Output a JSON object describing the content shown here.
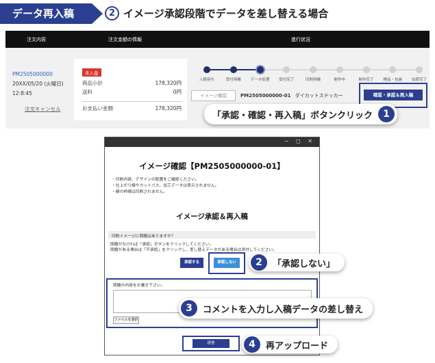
{
  "header": {
    "section_label": "データ再入稿",
    "step_number": "2",
    "step_title": "イメージ承認段階でデータを差し替える場合"
  },
  "table_header": {
    "col_order": "注文内容",
    "col_amount": "注文金額の情報",
    "col_status": "進行状況"
  },
  "order": {
    "id": "PM2505000000",
    "date": "20XX/05/20 (火曜日)",
    "time": "12:8:45",
    "cancel_label": "注文キャンセル"
  },
  "payment": {
    "badge": "未入金",
    "subtotal_label": "商品小計",
    "subtotal_value": "178,320円",
    "shipping_label": "送料",
    "shipping_value": "0円",
    "total_label": "お支払い金額",
    "total_value": "178,320円"
  },
  "progress": {
    "steps": [
      "入稿待ち",
      "受付待機",
      "データ処理",
      "受付完了",
      "印刷待機",
      "制作中",
      "制作完了",
      "検品・包装",
      "出荷完了"
    ],
    "current_index": 2
  },
  "item": {
    "image_confirm_button": "イメージ確認",
    "product_id": "PM2505000000-01",
    "product_name": "ダイカットステッカー",
    "action_button": "確認・承認＆再入稿"
  },
  "callouts": {
    "c1_text": "「承認・確認・再入稿」ボタンクリック",
    "c1_num": "1",
    "c2_text": "「承認しない」",
    "c2_num": "2",
    "c3_text": "コメントを入力し入稿データの差し替え",
    "c3_num": "3",
    "c4_text": "再アップロード",
    "c4_num": "4"
  },
  "dialog": {
    "window_controls": "− ◻ ✕",
    "title": "イメージ確認【PM2505000000-01】",
    "bullets": [
      "・印刷内容、デザインの配置をご確認ください。",
      "・仕上がり線やカットパス、加工データは表示されません。",
      "・線の枠線は印刷されません。"
    ],
    "subtitle": "イメージ承認＆再入稿",
    "question": "印刷イメージに問題はありますか？",
    "instructions": [
      "問題がなければ「承認」ボタンをクリックしてください。",
      "問題がある場合は「不承認」をクリックし、差し替えデータがある場合は添付してください。"
    ],
    "approve_button": "承認する",
    "reject_button": "承認しない",
    "comment_label": "問題の内容をお書き下さい。",
    "file_button": "ファイルを選択",
    "send_button": "送信"
  }
}
